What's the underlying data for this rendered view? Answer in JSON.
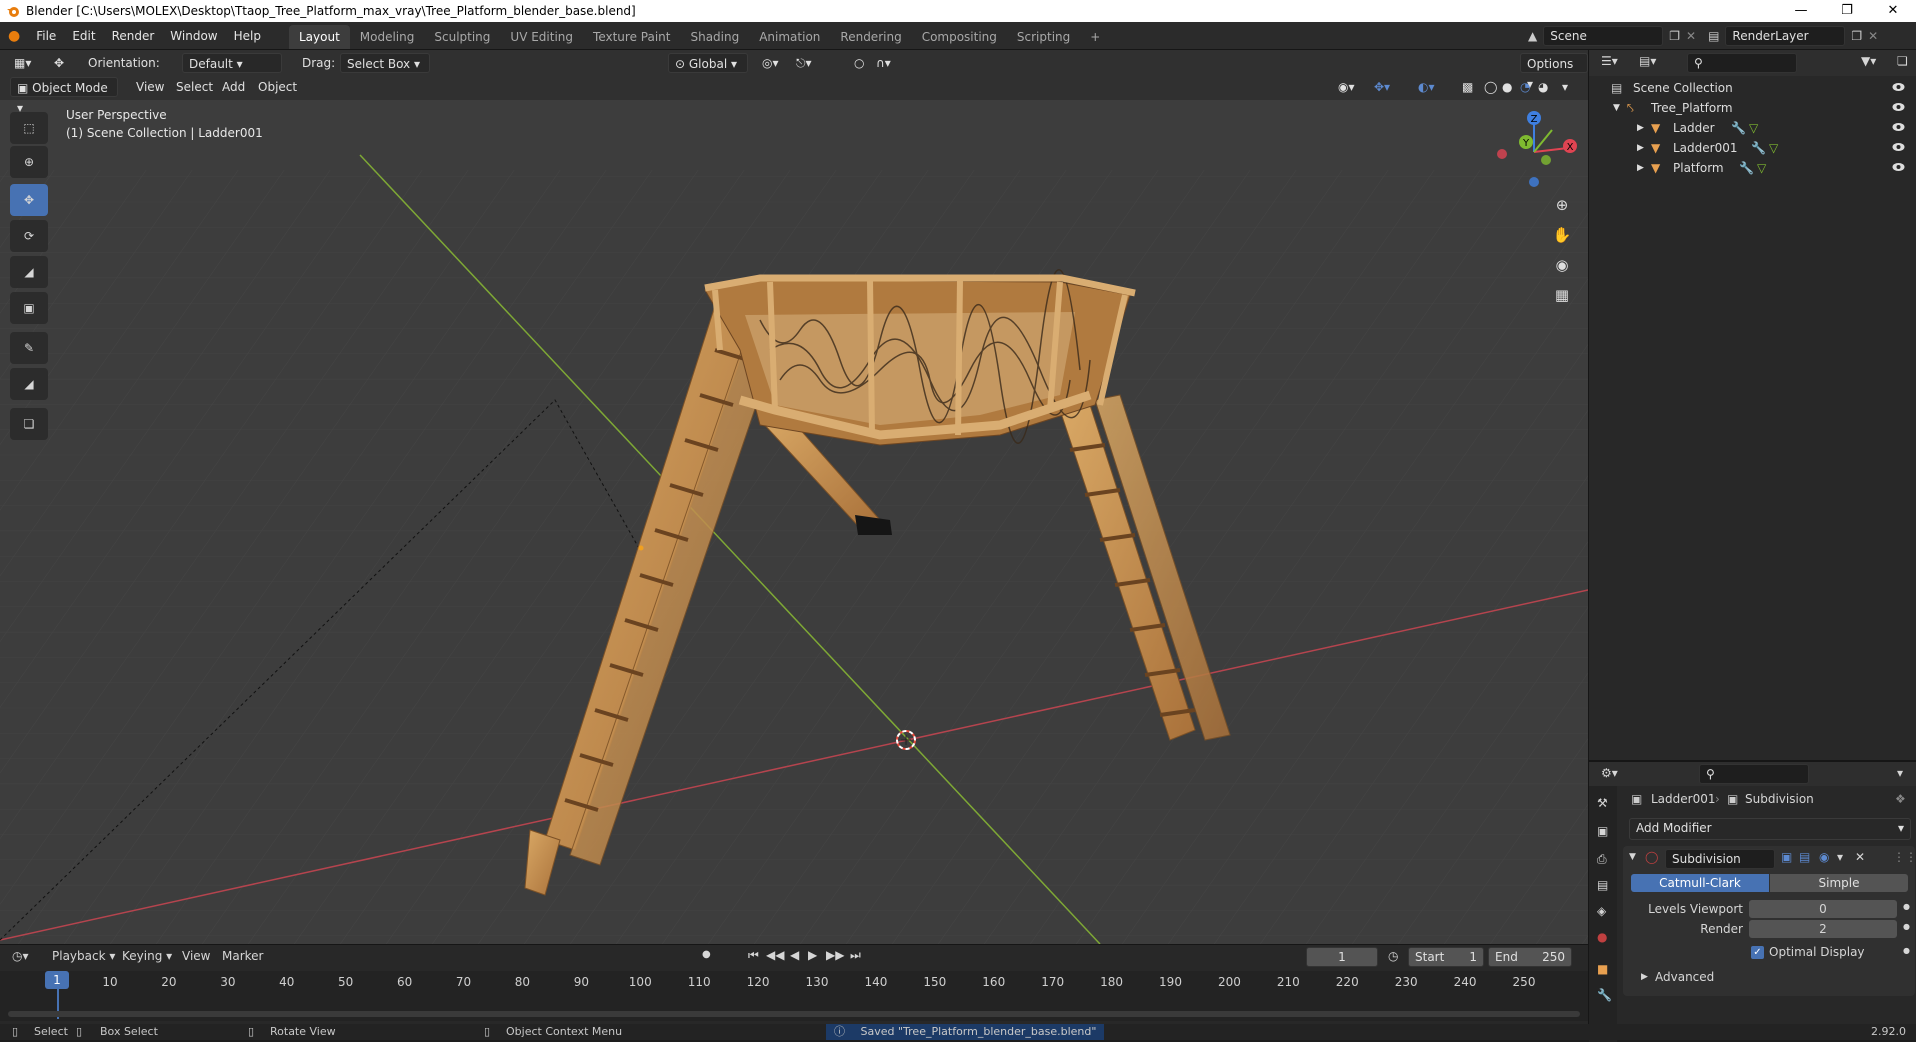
{
  "window": {
    "title": "Blender [C:\\Users\\MOLEX\\Desktop\\Ttaop_Tree_Platform_max_vray\\Tree_Platform_blender_base.blend]"
  },
  "topbar": {
    "menus": [
      "File",
      "Edit",
      "Render",
      "Window",
      "Help"
    ],
    "workspaces": [
      "Layout",
      "Modeling",
      "Sculpting",
      "UV Editing",
      "Texture Paint",
      "Shading",
      "Animation",
      "Rendering",
      "Compositing",
      "Scripting"
    ],
    "active_workspace": "Layout",
    "add_tab": "+",
    "scene": "Scene",
    "render_layer": "RenderLayer"
  },
  "viewport_header": {
    "orientation_label": "Orientation:",
    "orientation_value": "Default",
    "drag_label": "Drag:",
    "drag_value": "Select Box",
    "transform_space": "Global",
    "options": "Options",
    "mode": "Object Mode",
    "menus": [
      "View",
      "Select",
      "Add",
      "Object"
    ]
  },
  "viewport": {
    "perspective": "User Perspective",
    "collection_info": "(1) Scene Collection | Ladder001",
    "gizmo": {
      "x": "X",
      "y": "Y",
      "z": "Z"
    }
  },
  "outliner": {
    "root": "Scene Collection",
    "collection": "Tree_Platform",
    "objects": [
      "Ladder",
      "Ladder001",
      "Platform"
    ]
  },
  "properties": {
    "object": "Ladder001",
    "modifier_tab": "Subdivision",
    "add_modifier": "Add Modifier",
    "modifier_name": "Subdivision",
    "type_catmull": "Catmull-Clark",
    "type_simple": "Simple",
    "levels_viewport_label": "Levels Viewport",
    "levels_viewport_value": "0",
    "render_label": "Render",
    "render_value": "2",
    "optimal_display": "Optimal Display",
    "advanced": "Advanced"
  },
  "timeline": {
    "menus": [
      "Playback",
      "Keying",
      "View",
      "Marker"
    ],
    "current_frame": "1",
    "start_label": "Start",
    "start_value": "1",
    "end_label": "End",
    "end_value": "250",
    "ticks": [
      "1",
      "10",
      "20",
      "30",
      "40",
      "50",
      "60",
      "70",
      "80",
      "90",
      "100",
      "110",
      "120",
      "130",
      "140",
      "150",
      "160",
      "170",
      "180",
      "190",
      "200",
      "210",
      "220",
      "230",
      "240",
      "250"
    ]
  },
  "statusbar": {
    "select": "Select",
    "box_select": "Box Select",
    "rotate_view": "Rotate View",
    "context_menu": "Object Context Menu",
    "message": "Saved \"Tree_Platform_blender_base.blend\"",
    "version": "2.92.0"
  },
  "colors": {
    "accent": "#4772b3",
    "x_axis": "#e04452",
    "y_axis": "#7fba30",
    "z_axis": "#3f7fe0",
    "wood": "#c8944e"
  }
}
